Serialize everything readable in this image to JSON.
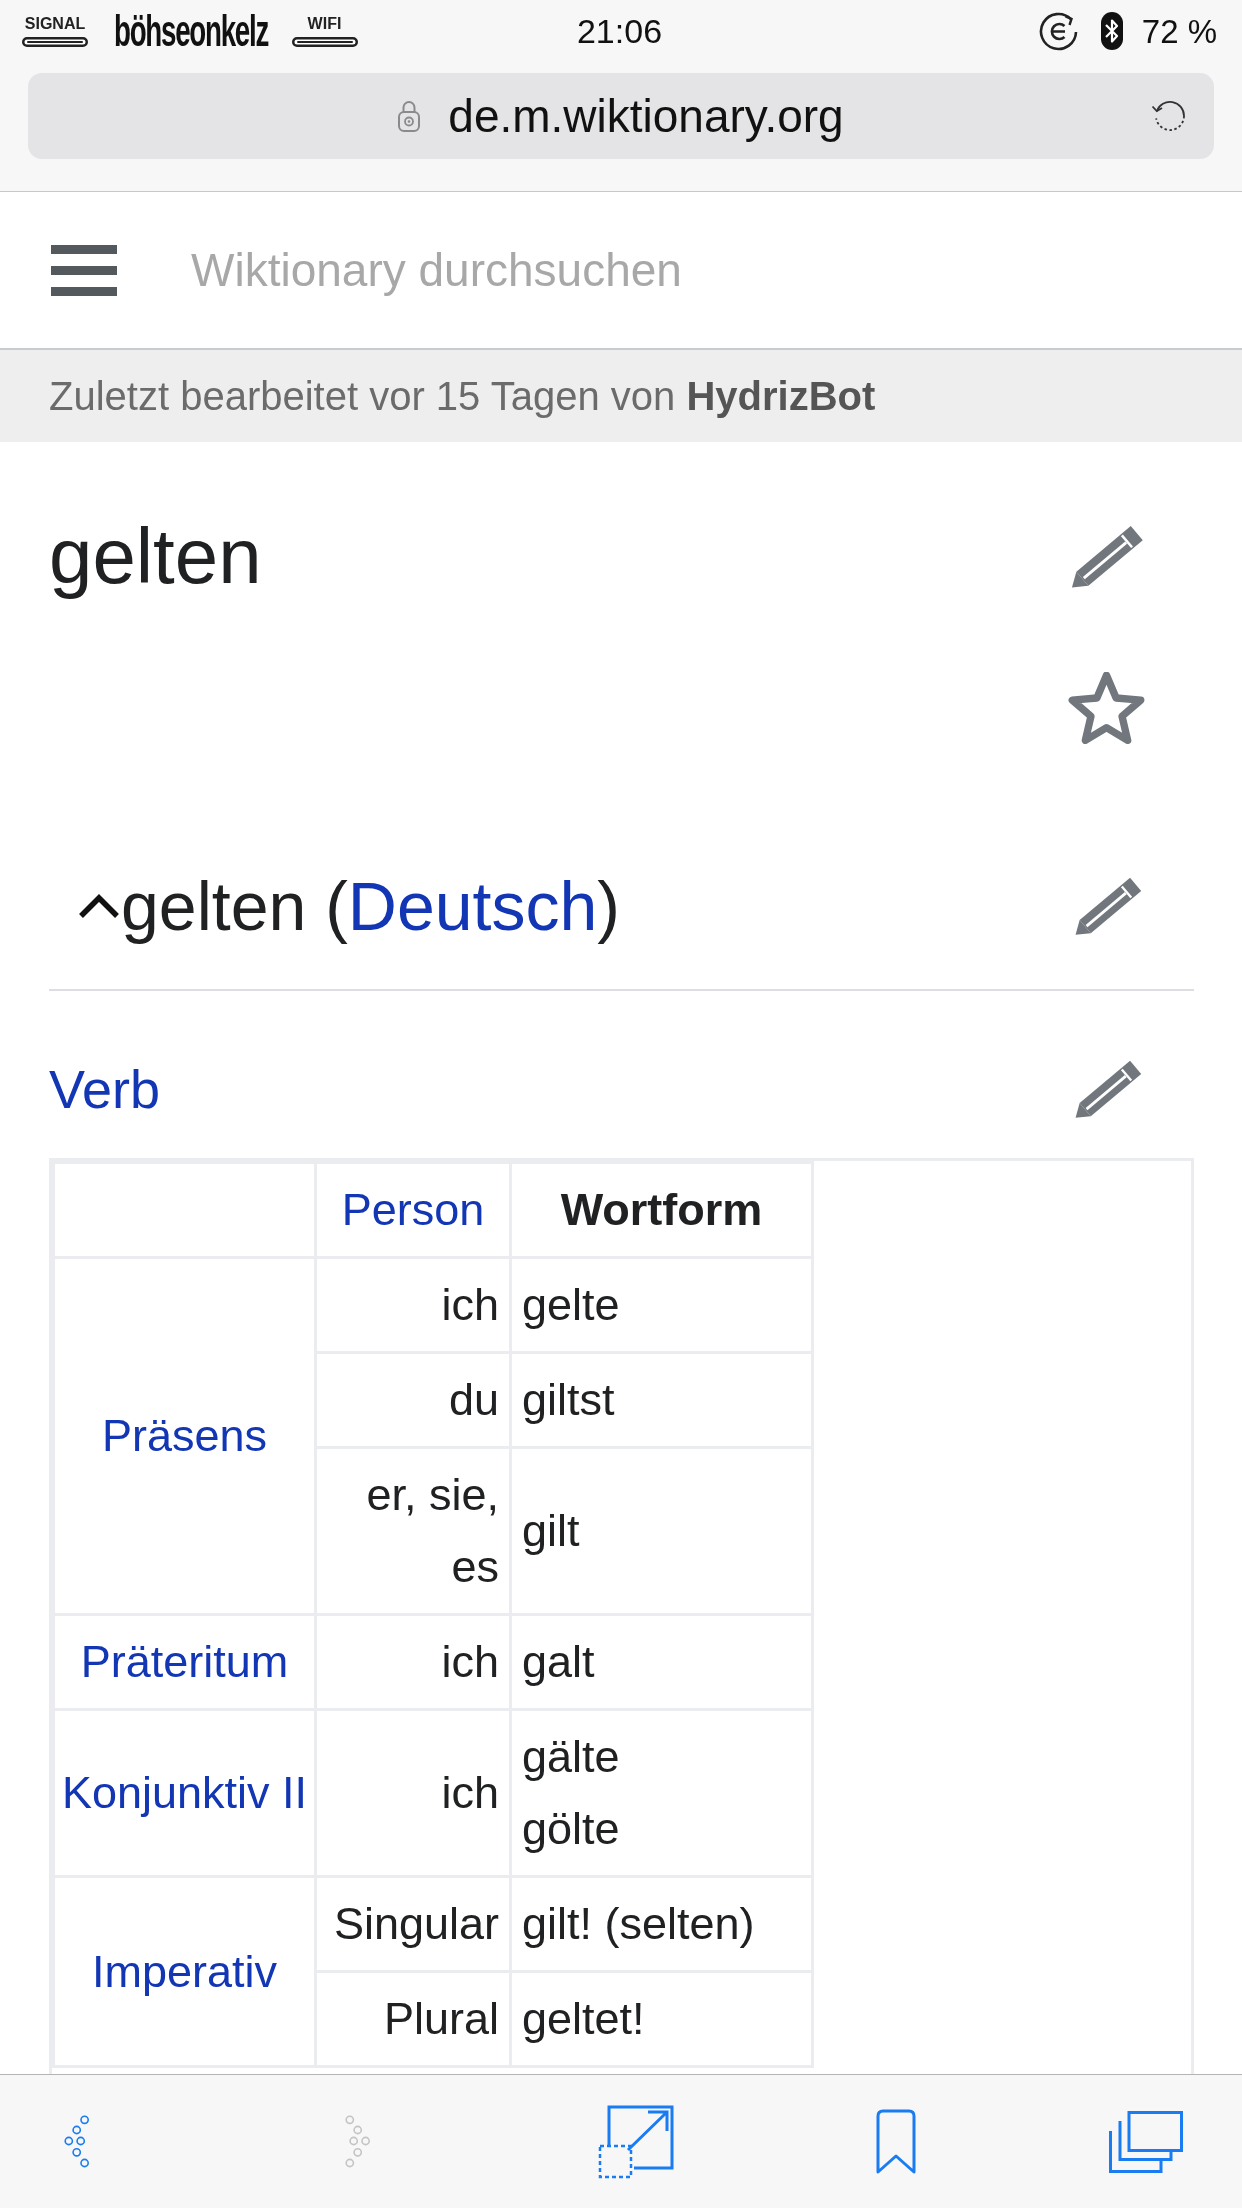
{
  "status_bar": {
    "signal_label": "SIGNAL",
    "carrier": "böhseonkelz",
    "wifi_label": "WIFI",
    "time": "21:06",
    "battery": "72 %"
  },
  "address_bar": {
    "secure": true,
    "url": "de.m.wiktionary.org"
  },
  "header": {
    "search": {
      "placeholder": "Wiktionary durchsuchen"
    }
  },
  "last_edited": "Zuletzt bearbeitet vor 15 Tagen von **HydrizBot**",
  "page": {
    "title": "gelten"
  },
  "section": {
    "prefix": "gelten (",
    "language": "Deutsch",
    "suffix": ")",
    "expanded": true,
    "subsection": {
      "title": "Verb",
      "table": {
        "header": {
          "person": "Person",
          "form": "Wortform"
        },
        "groups": [
          {
            "label": "Präsens",
            "rows": [
              {
                "person": "ich",
                "forms": [
                  "gelte"
                ]
              },
              {
                "person": "du",
                "forms": [
                  "giltst"
                ]
              },
              {
                "person": "er, sie, es",
                "forms": [
                  "gilt"
                ]
              }
            ]
          },
          {
            "label": "Präteritum",
            "rows": [
              {
                "person": "ich",
                "forms": [
                  "galt"
                ]
              }
            ]
          },
          {
            "label": "Konjunktiv II",
            "rows": [
              {
                "person": "ich",
                "forms": [
                  "gälte",
                  "gölte"
                ]
              }
            ]
          },
          {
            "label": "Imperativ",
            "rows": [
              {
                "person": "Singular",
                "forms": [
                  "gilt! (selten)"
                ]
              },
              {
                "person": "Plural",
                "forms": [
                  "geltet!"
                ]
              }
            ]
          }
        ]
      }
    }
  },
  "toolbar": {
    "buttons": [
      {
        "kind": "back",
        "disabled": false
      },
      {
        "kind": "forward",
        "disabled": true
      },
      {
        "kind": "expand",
        "disabled": false
      },
      {
        "kind": "bookmark",
        "disabled": false
      },
      {
        "kind": "tabs",
        "disabled": false
      }
    ]
  }
}
